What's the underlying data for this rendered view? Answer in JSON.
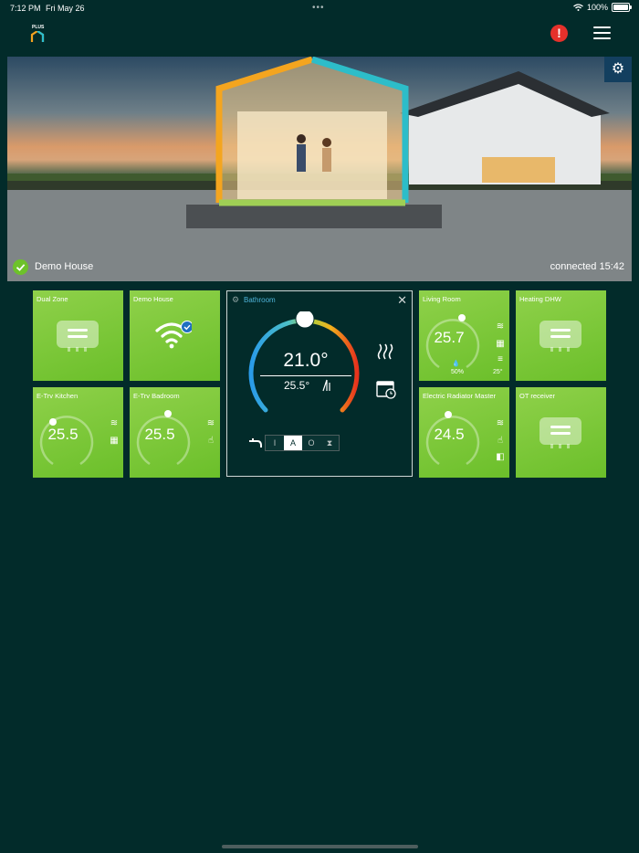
{
  "status": {
    "time": "7:12 PM",
    "date": "Fri May 26",
    "battery": "100%"
  },
  "header": {
    "logo_text": "PLUS"
  },
  "banner": {
    "house_name": "Demo House",
    "connected_text": "connected 15:42"
  },
  "tiles": [
    {
      "name": "Dual Zone"
    },
    {
      "name": "Demo House"
    },
    {
      "name": "Living Room",
      "temp": "25.7",
      "humidity": "50%",
      "outside": "25°"
    },
    {
      "name": "Heating DHW"
    },
    {
      "name": "E-Trv Kitchen",
      "temp": "25.5"
    },
    {
      "name": "E-Trv Badroom",
      "temp": "25.5"
    },
    {
      "name": "Electric Radiator Master",
      "temp": "24.5"
    },
    {
      "name": "OT receiver"
    }
  ],
  "panel": {
    "title": "Bathroom",
    "setpoint": "21.0°",
    "current": "25.5°",
    "modes": [
      "I",
      "A",
      "O",
      "⧗"
    ],
    "active_mode": "A"
  },
  "colors": {
    "background": "#022b2a",
    "tile_green": "#7ac638",
    "accent_blue": "#4fb3d9",
    "alert_red": "#e5312b"
  }
}
